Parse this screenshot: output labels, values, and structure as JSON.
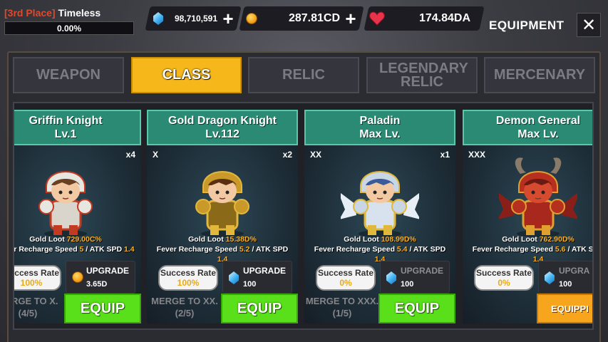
{
  "rank": {
    "place": "[3rd Place]",
    "title": "Timeless",
    "progress": "0.00%",
    "progress_fraction": 0.0
  },
  "currency": {
    "gems": {
      "icon": "gem-icon",
      "value": "98,710,591"
    },
    "gold": {
      "icon": "gold-coin-icon",
      "value": "287.81CD"
    },
    "hearts": {
      "icon": "heart-icon",
      "value": "174.84DA"
    }
  },
  "header": {
    "title": "EQUIPMENT",
    "close_label": "✕"
  },
  "tabs": [
    {
      "label": "WEAPON",
      "active": false
    },
    {
      "label": "CLASS",
      "active": true
    },
    {
      "label": "RELIC",
      "active": false
    },
    {
      "label": "LEGENDARY RELIC",
      "active": false
    },
    {
      "label": "MERCENARY",
      "active": false
    }
  ],
  "cards": [
    {
      "name": "Griffin Knight",
      "level": "Lv.1",
      "tier": "",
      "count": "x4",
      "stats_line1_label": "Gold Loot ",
      "stats_line1_value": "729.00C%",
      "stats_line2_label": "Fever Recharge Speed ",
      "stats_line2_value": "5",
      "stats_line2_mid": " / ATK SPD ",
      "stats_line2_value2": "1.4",
      "stats_line3": "",
      "success_label": "Success Rate",
      "success_value": "100%",
      "upgrade_label": "UPGRADE",
      "upgrade_cost": "3.65D",
      "upgrade_icon": "gold-coin-icon",
      "merge_text": "MERGE TO X.",
      "merge_progress": "(4/5)",
      "equip_label": "EQUIP"
    },
    {
      "name": "Gold Dragon Knight",
      "level": "Lv.112",
      "tier": "X",
      "count": "x2",
      "stats_line1_label": "Gold Loot ",
      "stats_line1_value": "15.38D%",
      "stats_line2_label": "Fever Recharge Speed ",
      "stats_line2_value": "5.2",
      "stats_line2_mid": " / ATK SPD",
      "stats_line2_value2": "",
      "stats_line3": "1.4",
      "success_label": "Success Rate",
      "success_value": "100%",
      "upgrade_label": "UPGRADE",
      "upgrade_cost": "100",
      "upgrade_icon": "gem-icon",
      "merge_text": "MERGE TO XX.",
      "merge_progress": "(2/5)",
      "equip_label": "EQUIP"
    },
    {
      "name": "Paladin",
      "level": "Max Lv.",
      "tier": "XX",
      "count": "x1",
      "stats_line1_label": "Gold Loot ",
      "stats_line1_value": "108.99D%",
      "stats_line2_label": "Fever Recharge Speed ",
      "stats_line2_value": "5.4",
      "stats_line2_mid": " / ATK SPD",
      "stats_line2_value2": "",
      "stats_line3": "1.4",
      "success_label": "Success Rate",
      "success_value": "0%",
      "upgrade_label": "UPGRADE",
      "upgrade_cost": "100",
      "upgrade_icon": "gem-icon",
      "merge_text": "MERGE TO XXX.",
      "merge_progress": "(1/5)",
      "equip_label": "EQUIP"
    },
    {
      "name": "Demon General",
      "level": "Max Lv.",
      "tier": "XXX",
      "count": "",
      "stats_line1_label": "Gold Loot ",
      "stats_line1_value": "762.90D%",
      "stats_line2_label": "Fever Recharge Speed ",
      "stats_line2_value": "5.6",
      "stats_line2_mid": " / ATK SPD",
      "stats_line2_value2": "",
      "stats_line3": "1.4",
      "success_label": "Success Rate",
      "success_value": "0%",
      "upgrade_label": "UPGRA",
      "upgrade_cost": "100",
      "upgrade_icon": "gem-icon",
      "merge_text": "",
      "merge_progress": "",
      "equip_label": "EQUIPPI"
    }
  ]
}
